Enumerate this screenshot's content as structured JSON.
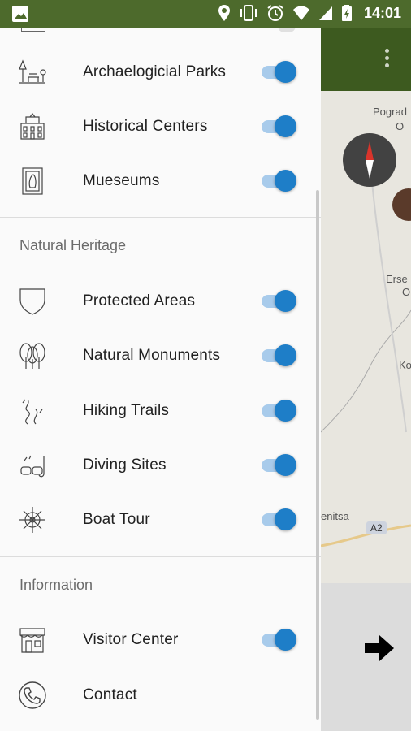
{
  "status_bar": {
    "time": "14:01",
    "icons": [
      "image-icon",
      "location-icon",
      "vibrate-icon",
      "alarm-icon",
      "wifi-icon",
      "signal-icon",
      "battery-icon"
    ]
  },
  "map": {
    "labels": [
      "Pogrаd",
      "O",
      "Erse",
      "O",
      "Ko",
      "enitsa"
    ],
    "road_label": "A2"
  },
  "drawer": {
    "items_top": [
      {
        "label": "Archaelogicial Parks",
        "icon": "park-icon",
        "enabled": true
      },
      {
        "label": "Historical Centers",
        "icon": "building-icon",
        "enabled": true
      },
      {
        "label": "Mueseums",
        "icon": "museum-icon",
        "enabled": true
      }
    ],
    "section_natural": "Natural Heritage",
    "items_natural": [
      {
        "label": "Protected Areas",
        "icon": "shield-icon",
        "enabled": true
      },
      {
        "label": "Natural Monuments",
        "icon": "trees-icon",
        "enabled": true
      },
      {
        "label": "Hiking Trails",
        "icon": "trail-icon",
        "enabled": true
      },
      {
        "label": "Diving Sites",
        "icon": "diving-mask-icon",
        "enabled": true
      },
      {
        "label": "Boat Tour",
        "icon": "ship-wheel-icon",
        "enabled": true
      }
    ],
    "section_information": "Information",
    "items_information": [
      {
        "label": "Visitor Center",
        "icon": "store-icon",
        "enabled": true
      },
      {
        "label": "Contact",
        "icon": "phone-icon"
      }
    ]
  },
  "colors": {
    "status_bar": "#4d6a2c",
    "app_bar": "#3d5a1f",
    "switch_thumb": "#1e7ec8",
    "switch_track": "#a8cbeb"
  }
}
